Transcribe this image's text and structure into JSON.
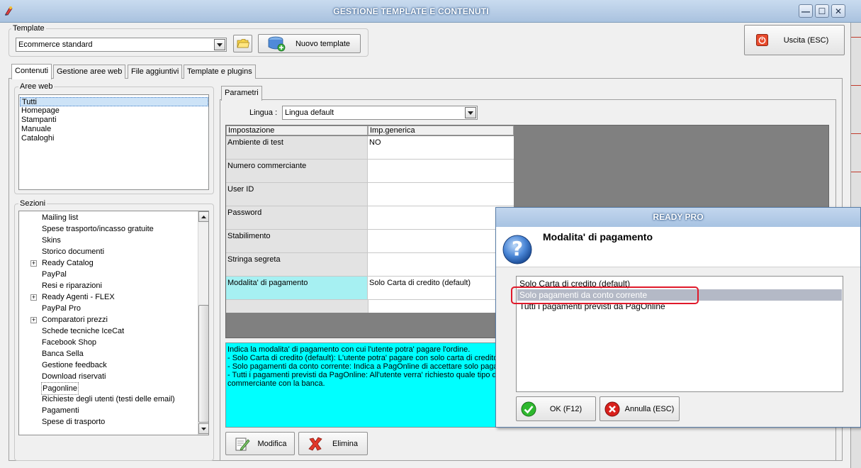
{
  "window": {
    "title": "GESTIONE TEMPLATE E CONTENUTI",
    "minimize_glyph": "—",
    "maximize_glyph": "☐",
    "close_glyph": "✕"
  },
  "template": {
    "group_label": "Template",
    "selected": "Ecommerce standard",
    "new_button_label": "Nuovo template"
  },
  "exit_button_label": "Uscita (ESC)",
  "tabs": [
    {
      "label": "Contenuti",
      "active": true
    },
    {
      "label": "Gestione aree web",
      "active": false
    },
    {
      "label": "File aggiuntivi",
      "active": false
    },
    {
      "label": "Template e plugins",
      "active": false
    }
  ],
  "aree_web": {
    "label": "Aree web",
    "items": [
      "Tutti",
      "Homepage",
      "Stampanti",
      "Manuale",
      "Cataloghi"
    ],
    "selected_index": 0
  },
  "sezioni": {
    "label": "Sezioni",
    "items": [
      {
        "label": "Mailing list",
        "expandable": false
      },
      {
        "label": "Spese trasporto/incasso gratuite",
        "expandable": false
      },
      {
        "label": "Skins",
        "expandable": false
      },
      {
        "label": "Storico documenti",
        "expandable": false
      },
      {
        "label": "Ready Catalog",
        "expandable": true
      },
      {
        "label": "PayPal",
        "expandable": false
      },
      {
        "label": "Resi e riparazioni",
        "expandable": false
      },
      {
        "label": "Ready Agenti - FLEX",
        "expandable": true
      },
      {
        "label": "PayPal Pro",
        "expandable": false
      },
      {
        "label": "Comparatori prezzi",
        "expandable": true
      },
      {
        "label": "Schede tecniche IceCat",
        "expandable": false
      },
      {
        "label": "Facebook Shop",
        "expandable": false
      },
      {
        "label": "Banca Sella",
        "expandable": false
      },
      {
        "label": "Gestione feedback",
        "expandable": false
      },
      {
        "label": "Download riservati",
        "expandable": false
      },
      {
        "label": "Pagonline",
        "expandable": false
      },
      {
        "label": "Richieste degli utenti (testi delle email)",
        "expandable": false
      },
      {
        "label": "Pagamenti",
        "expandable": false
      },
      {
        "label": "Spese di trasporto",
        "expandable": false
      }
    ],
    "selected_index": 15,
    "expand_glyph": "+"
  },
  "parametri": {
    "tab_label": "Parametri",
    "lingua_label": "Lingua :",
    "lingua_value": "Lingua default",
    "columns": [
      "Impostazione",
      "Imp.generica"
    ],
    "rows": [
      {
        "name": "Ambiente di test",
        "value": "NO"
      },
      {
        "name": "Numero commerciante",
        "value": ""
      },
      {
        "name": "User ID",
        "value": ""
      },
      {
        "name": "Password",
        "value": ""
      },
      {
        "name": "Stabilimento",
        "value": ""
      },
      {
        "name": "Stringa segreta",
        "value": ""
      },
      {
        "name": "Modalita' di pagamento",
        "value": "Solo Carta di credito (default)"
      }
    ],
    "highlighted_row": 6,
    "description": [
      "Indica la modalita' di pagamento con cui l'utente potra' pagare l'ordine.",
      "- Solo Carta di credito (default): L'utente potra' pagare con solo carta di credito",
      "- Solo pagamenti da conto corrente: Indica a PagOnline di accettare solo pagam",
      "- Tutti i pagamenti previsti da PagOnline: All'utente verra' richiesto quale tipo di",
      "commerciante con la banca."
    ],
    "modify_button_label": "Modifica",
    "delete_button_label": "Elimina"
  },
  "dialog": {
    "title": "READY PRO",
    "heading": "Modalita' di pagamento",
    "icon_glyph": "?",
    "options": [
      "Solo Carta di credito (default)",
      "Solo pagamenti da conto corrente",
      "Tutti i pagamenti previsti da PagOnline"
    ],
    "selected_index": 1,
    "ok_label": "OK (F12)",
    "cancel_label": "Annulla (ESC)"
  },
  "colors": {
    "description_bg": "#00ffff",
    "highlight_row_bg": "#a6f0f2",
    "annotation_red": "#e0192a",
    "ok_green": "#2eb82e",
    "cancel_red": "#d8201c"
  }
}
